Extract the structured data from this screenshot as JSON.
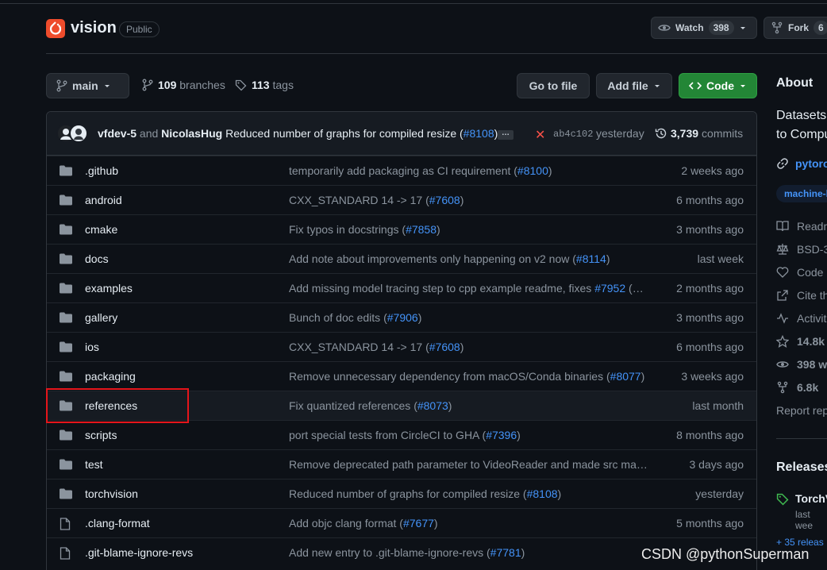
{
  "repo": {
    "name": "vision",
    "visibility": "Public",
    "watch_label": "Watch",
    "watch_count": "398",
    "fork_label": "Fork",
    "fork_count": "6"
  },
  "branch_bar": {
    "branch": "main",
    "branches_count": "109",
    "branches_label": "branches",
    "tags_count": "113",
    "tags_label": "tags",
    "go_to_file": "Go to file",
    "add_file": "Add file",
    "code": "Code"
  },
  "latest_commit": {
    "author1": "vfdev-5",
    "and": "and",
    "author2": "NicolasHug",
    "message": "Reduced number of graphs for compiled resize (",
    "pr": "#8108",
    "message_end": ")",
    "ellipsis": "…",
    "sha": "ab4c102",
    "when": "yesterday",
    "commits_count": "3,739",
    "commits_label": "commits"
  },
  "files": [
    {
      "type": "dir",
      "name": ".github",
      "msg": "temporarily add packaging as CI requirement (",
      "pr": "#8100",
      "end": ")",
      "age": "2 weeks ago"
    },
    {
      "type": "dir",
      "name": "android",
      "msg": "CXX_STANDARD 14 -> 17 (",
      "pr": "#7608",
      "end": ")",
      "age": "6 months ago"
    },
    {
      "type": "dir",
      "name": "cmake",
      "msg": "Fix typos in docstrings (",
      "pr": "#7858",
      "end": ")",
      "age": "3 months ago"
    },
    {
      "type": "dir",
      "name": "docs",
      "msg": "Add note about improvements only happening on v2 now (",
      "pr": "#8114",
      "end": ")",
      "age": "last week"
    },
    {
      "type": "dir",
      "name": "examples",
      "msg": "Add missing model tracing step to cpp example readme, fixes ",
      "pr": "#7952",
      "end": " (#…",
      "age": "2 months ago"
    },
    {
      "type": "dir",
      "name": "gallery",
      "msg": "Bunch of doc edits (",
      "pr": "#7906",
      "end": ")",
      "age": "3 months ago"
    },
    {
      "type": "dir",
      "name": "ios",
      "msg": "CXX_STANDARD 14 -> 17 (",
      "pr": "#7608",
      "end": ")",
      "age": "6 months ago"
    },
    {
      "type": "dir",
      "name": "packaging",
      "msg": "Remove unnecessary dependency from macOS/Conda binaries (",
      "pr": "#8077",
      "end": ")",
      "age": "3 weeks ago"
    },
    {
      "type": "dir",
      "name": "references",
      "msg": "Fix quantized references (",
      "pr": "#8073",
      "end": ")",
      "age": "last month"
    },
    {
      "type": "dir",
      "name": "scripts",
      "msg": "port special tests from CircleCI to GHA (",
      "pr": "#7396",
      "end": ")",
      "age": "8 months ago"
    },
    {
      "type": "dir",
      "name": "test",
      "msg": "Remove deprecated path parameter to VideoReader and made src man…",
      "pr": "",
      "end": "",
      "age": "3 days ago"
    },
    {
      "type": "dir",
      "name": "torchvision",
      "msg": "Reduced number of graphs for compiled resize (",
      "pr": "#8108",
      "end": ")",
      "age": "yesterday"
    },
    {
      "type": "file",
      "name": ".clang-format",
      "msg": "Add objc clang format (",
      "pr": "#7677",
      "end": ")",
      "age": "5 months ago"
    },
    {
      "type": "file",
      "name": ".git-blame-ignore-revs",
      "msg": "Add new entry to .git-blame-ignore-revs (",
      "pr": "#7781",
      "end": ")",
      "age": ""
    }
  ],
  "sidebar": {
    "about": "About",
    "desc_line1": "Datasets,",
    "desc_line2": "to Compu",
    "website": "pytorc",
    "topic": "machine-l",
    "readme": "Readm",
    "license": "BSD-3",
    "conduct": "Code",
    "cite": "Cite th",
    "activity": "Activit",
    "stars": "14.8k",
    "watching": "398 w",
    "forks": "6.8k",
    "report": "Report rep",
    "releases": "Releases",
    "release_name": "TorchV",
    "release_date": "last wee",
    "more_releases": "+ 35 releas"
  },
  "watermark": "CSDN @pythonSuperman",
  "colors": {
    "accent": "#4493f8",
    "code_button": "#238636",
    "highlight_box": "#e5151b",
    "fail": "#f85149"
  }
}
